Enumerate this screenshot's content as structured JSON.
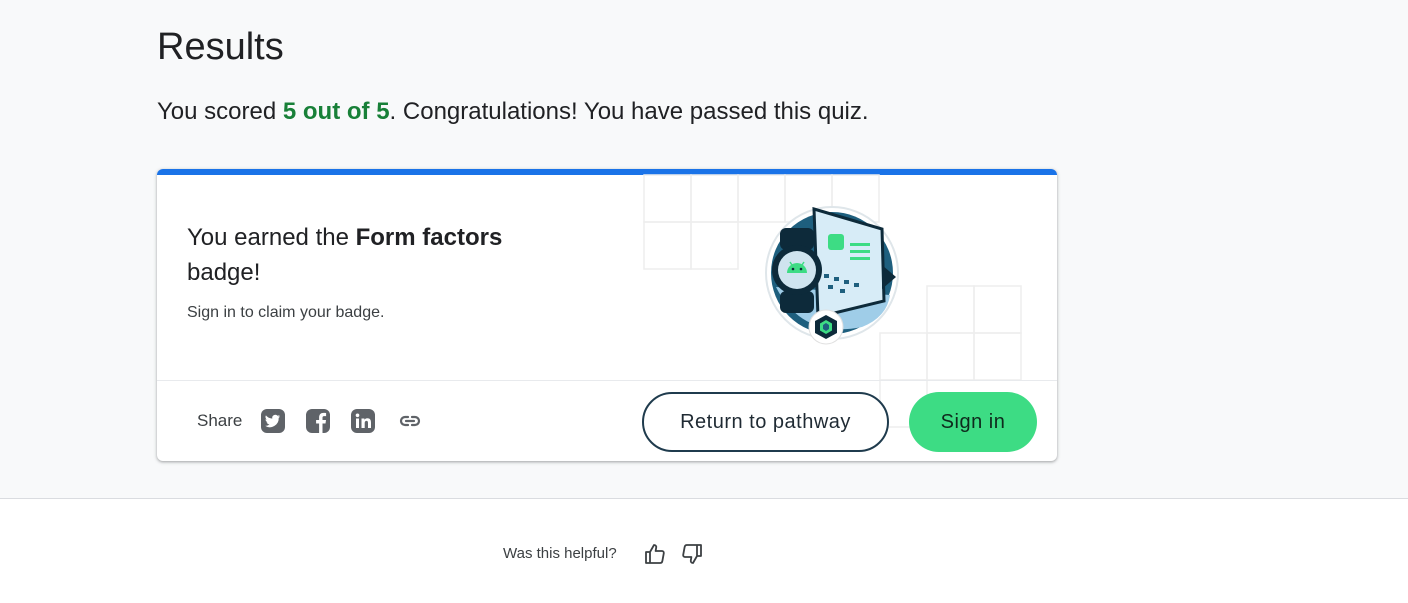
{
  "results": {
    "title": "Results",
    "score_prefix": "You scored ",
    "score_value": "5 out of 5",
    "score_suffix": ". Congratulations! You have passed this quiz."
  },
  "badge_card": {
    "earned_prefix": "You earned the ",
    "badge_name": "Form factors",
    "earned_suffix": "badge!",
    "claim_text": "Sign in to claim your badge.",
    "share_label": "Share",
    "share_icons": [
      "twitter-icon",
      "facebook-icon",
      "linkedin-icon",
      "link-icon"
    ],
    "return_button": "Return to pathway",
    "signin_button": "Sign in",
    "accent_color": "#1a73e8",
    "signin_color": "#3ddc84"
  },
  "feedback": {
    "question": "Was this helpful?",
    "icons": [
      "thumbs-up-icon",
      "thumbs-down-icon"
    ]
  },
  "colors": {
    "score_green": "#188038",
    "page_background": "#f8f9fa"
  }
}
